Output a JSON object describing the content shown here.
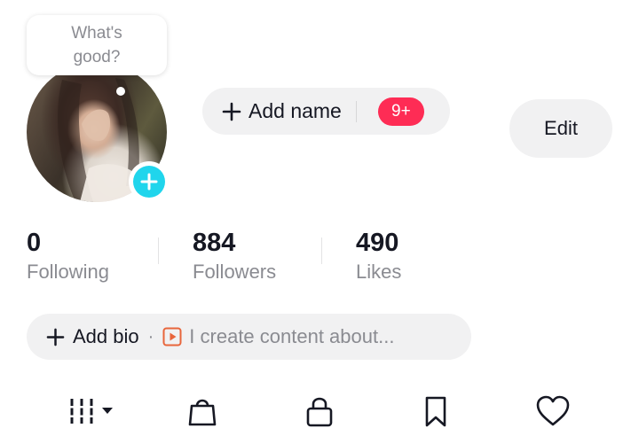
{
  "profile": {
    "note": "What's\ngood?",
    "add_name_label": "Add name",
    "notification_badge": "9+",
    "edit_label": "Edit"
  },
  "stats": [
    {
      "value": "0",
      "label": "Following"
    },
    {
      "value": "884",
      "label": "Followers"
    },
    {
      "value": "490",
      "label": "Likes"
    }
  ],
  "bio": {
    "add_label": "Add bio",
    "separator": "·",
    "placeholder": "I create content about..."
  },
  "tabs": [
    {
      "icon": "grid-icon",
      "active": true
    },
    {
      "icon": "shopping-bag-icon"
    },
    {
      "icon": "lock-icon"
    },
    {
      "icon": "bookmark-icon"
    },
    {
      "icon": "heart-icon"
    }
  ],
  "colors": {
    "accent_cyan": "#20d5ec",
    "badge_red": "#fe2c55",
    "pill_gray": "#f1f1f2",
    "secondary_text": "#8a8b91"
  }
}
